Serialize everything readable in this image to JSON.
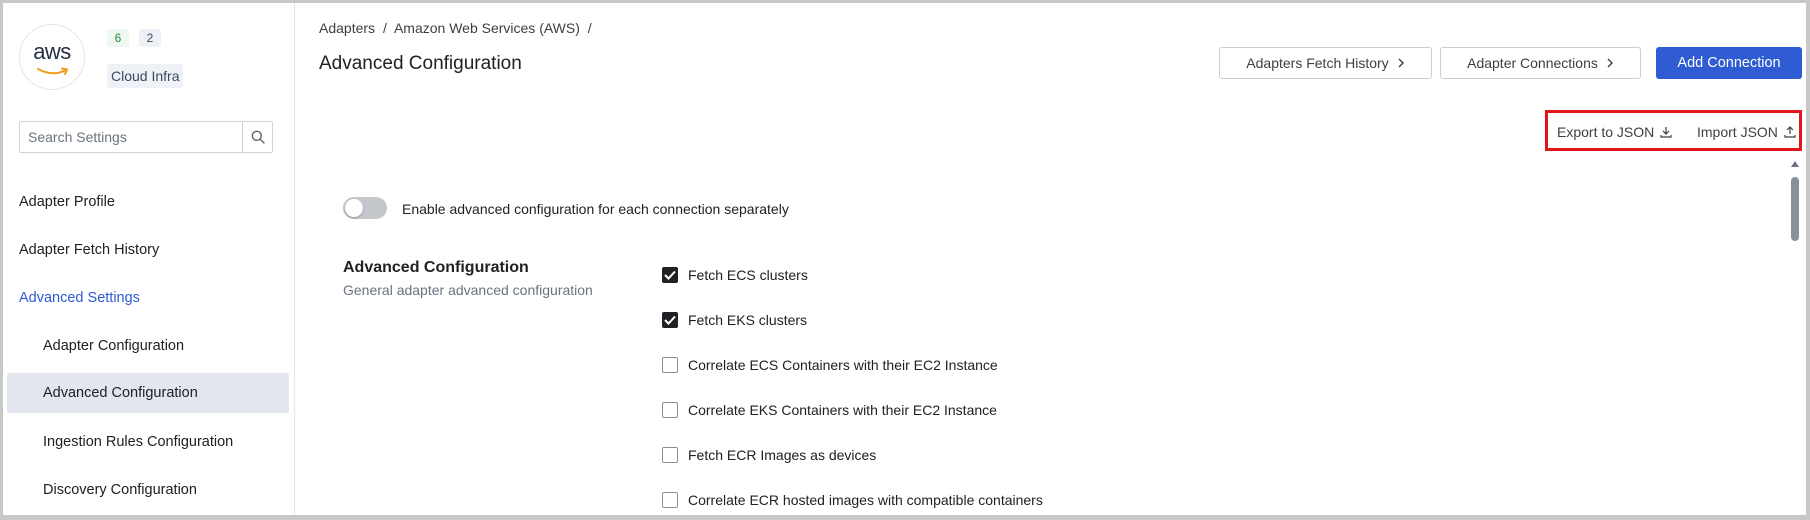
{
  "sidebar": {
    "logo_text": "aws",
    "badge_green": "6",
    "badge_blue": "2",
    "category": "Cloud Infra",
    "search_placeholder": "Search Settings",
    "items": [
      {
        "label": "Adapter Profile"
      },
      {
        "label": "Adapter Fetch History"
      },
      {
        "label": "Advanced Settings"
      },
      {
        "label": "Adapter Configuration"
      },
      {
        "label": "Advanced Configuration"
      },
      {
        "label": "Ingestion Rules Configuration"
      },
      {
        "label": "Discovery Configuration"
      }
    ]
  },
  "header": {
    "breadcrumb": [
      "Adapters",
      "/",
      "Amazon Web Services (AWS)",
      "/"
    ],
    "title": "Advanced Configuration",
    "fetch_history_button": "Adapters Fetch History",
    "connections_button": "Adapter Connections",
    "add_connection_button": "Add Connection",
    "export_json": "Export to JSON",
    "import_json": "Import JSON"
  },
  "content": {
    "toggle_label": "Enable advanced configuration for each connection separately",
    "toggle_on": false,
    "section_title": "Advanced Configuration",
    "section_subtitle": "General adapter advanced configuration",
    "options": [
      {
        "label": "Fetch ECS clusters",
        "checked": true
      },
      {
        "label": "Fetch EKS clusters",
        "checked": true
      },
      {
        "label": "Correlate ECS Containers with their EC2 Instance",
        "checked": false
      },
      {
        "label": "Correlate EKS Containers with their EC2 Instance",
        "checked": false
      },
      {
        "label": "Fetch ECR Images as devices",
        "checked": false
      },
      {
        "label": "Correlate ECR hosted images with compatible containers",
        "checked": false
      }
    ]
  },
  "colors": {
    "accent": "#2f5bd3",
    "highlight_box": "#e0161b",
    "selected_bg": "#e3e6ee"
  }
}
